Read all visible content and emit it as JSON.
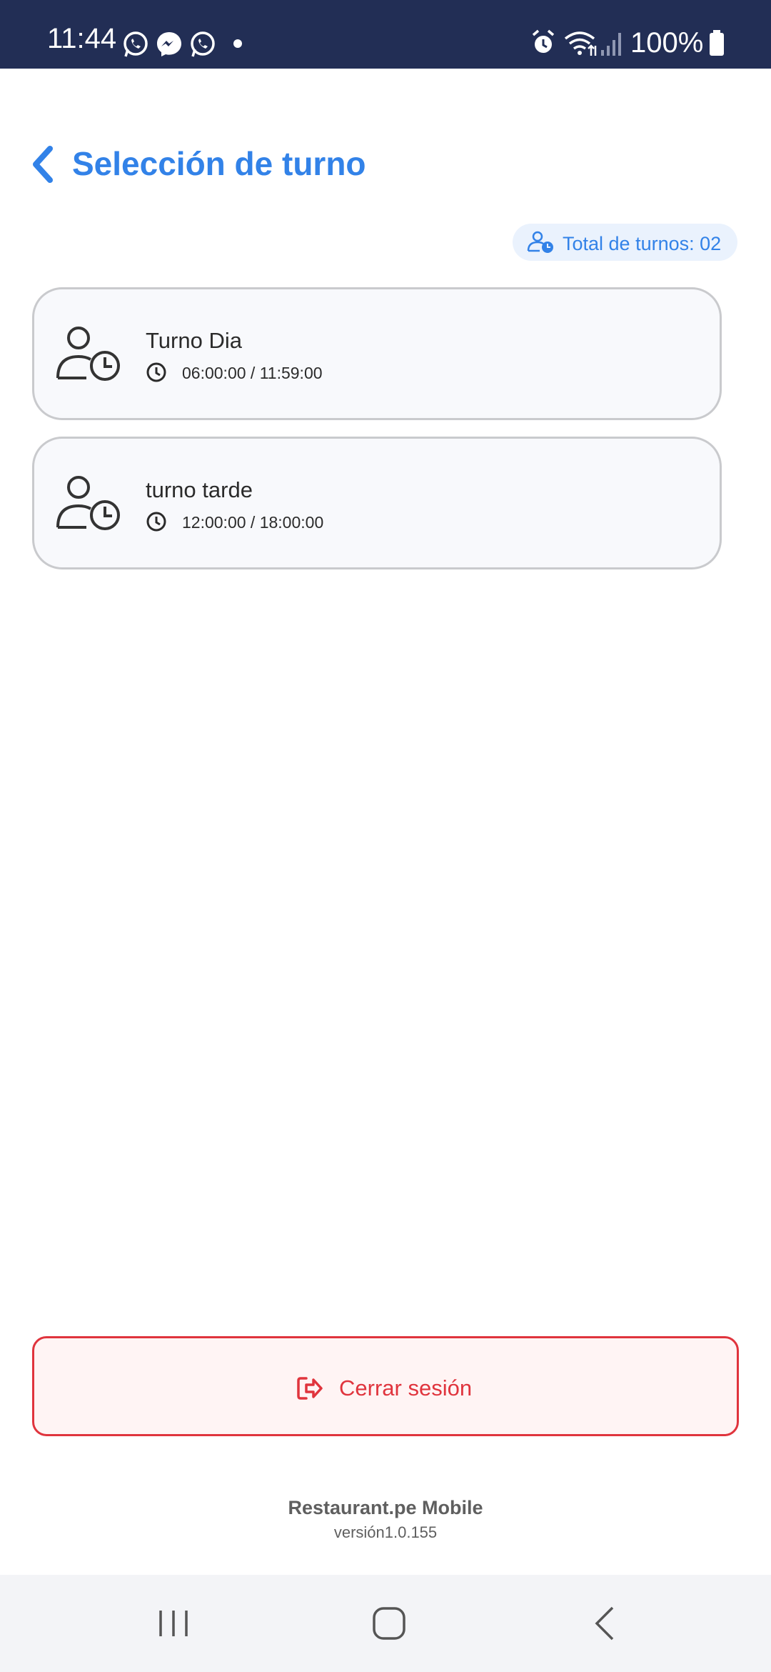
{
  "status_bar": {
    "time": "11:44",
    "battery": "100%",
    "notification_icons": [
      "whatsapp-icon",
      "messenger-icon",
      "whatsapp-icon"
    ],
    "system_icons": [
      "alarm-icon",
      "wifi-icon",
      "signal-icon",
      "battery-icon"
    ]
  },
  "header": {
    "title": "Selección de turno"
  },
  "badge": {
    "total_label": "Total de turnos: 02"
  },
  "shifts": [
    {
      "name": "Turno Dia",
      "hours": "06:00:00 / 11:59:00"
    },
    {
      "name": "turno tarde",
      "hours": "12:00:00 / 18:00:00"
    }
  ],
  "logout": {
    "label": "Cerrar sesión"
  },
  "footer": {
    "app_name": "Restaurant.pe Mobile",
    "version": "versión1.0.155"
  },
  "colors": {
    "accent": "#3282e8",
    "danger": "#e0343d",
    "status_bar": "#222e55"
  }
}
